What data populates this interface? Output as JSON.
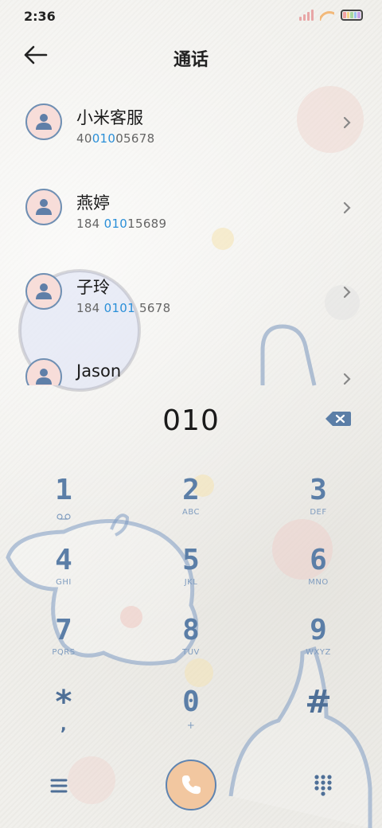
{
  "status_bar": {
    "time": "2:36",
    "battery_colors": [
      "#f2a2a2",
      "#f6d58a",
      "#a7d8a0",
      "#9bc4ef",
      "#c9a6e8"
    ]
  },
  "header": {
    "title": "通话",
    "back_icon": "arrow-left-icon"
  },
  "contacts": [
    {
      "name": "小米客服",
      "number_parts": [
        "40",
        "010",
        "05678"
      ]
    },
    {
      "name": "燕婷",
      "number_parts": [
        "184 ",
        "010",
        "15689"
      ]
    },
    {
      "name": "子玲",
      "number_parts": [
        "184 ",
        "0101",
        " 5678"
      ]
    },
    {
      "name": "Jason",
      "number_parts": [
        "",
        "",
        ""
      ]
    }
  ],
  "dialer": {
    "input": "010",
    "keys": [
      {
        "digit": "1",
        "letters": ""
      },
      {
        "digit": "2",
        "letters": "ABC"
      },
      {
        "digit": "3",
        "letters": "DEF"
      },
      {
        "digit": "4",
        "letters": "GHI"
      },
      {
        "digit": "5",
        "letters": "JKL"
      },
      {
        "digit": "6",
        "letters": "MNO"
      },
      {
        "digit": "7",
        "letters": "PQRS"
      },
      {
        "digit": "8",
        "letters": "TUV"
      },
      {
        "digit": "9",
        "letters": "WXYZ"
      },
      {
        "digit": "*",
        "letters": ","
      },
      {
        "digit": "0",
        "letters": "+"
      },
      {
        "digit": "#",
        "letters": ""
      }
    ]
  },
  "colors": {
    "accent_blue": "#2a8fd8",
    "key_blue": "#5b7ea7",
    "call_button": "#f2c7a0",
    "avatar_bg": "#f7ddd9"
  }
}
